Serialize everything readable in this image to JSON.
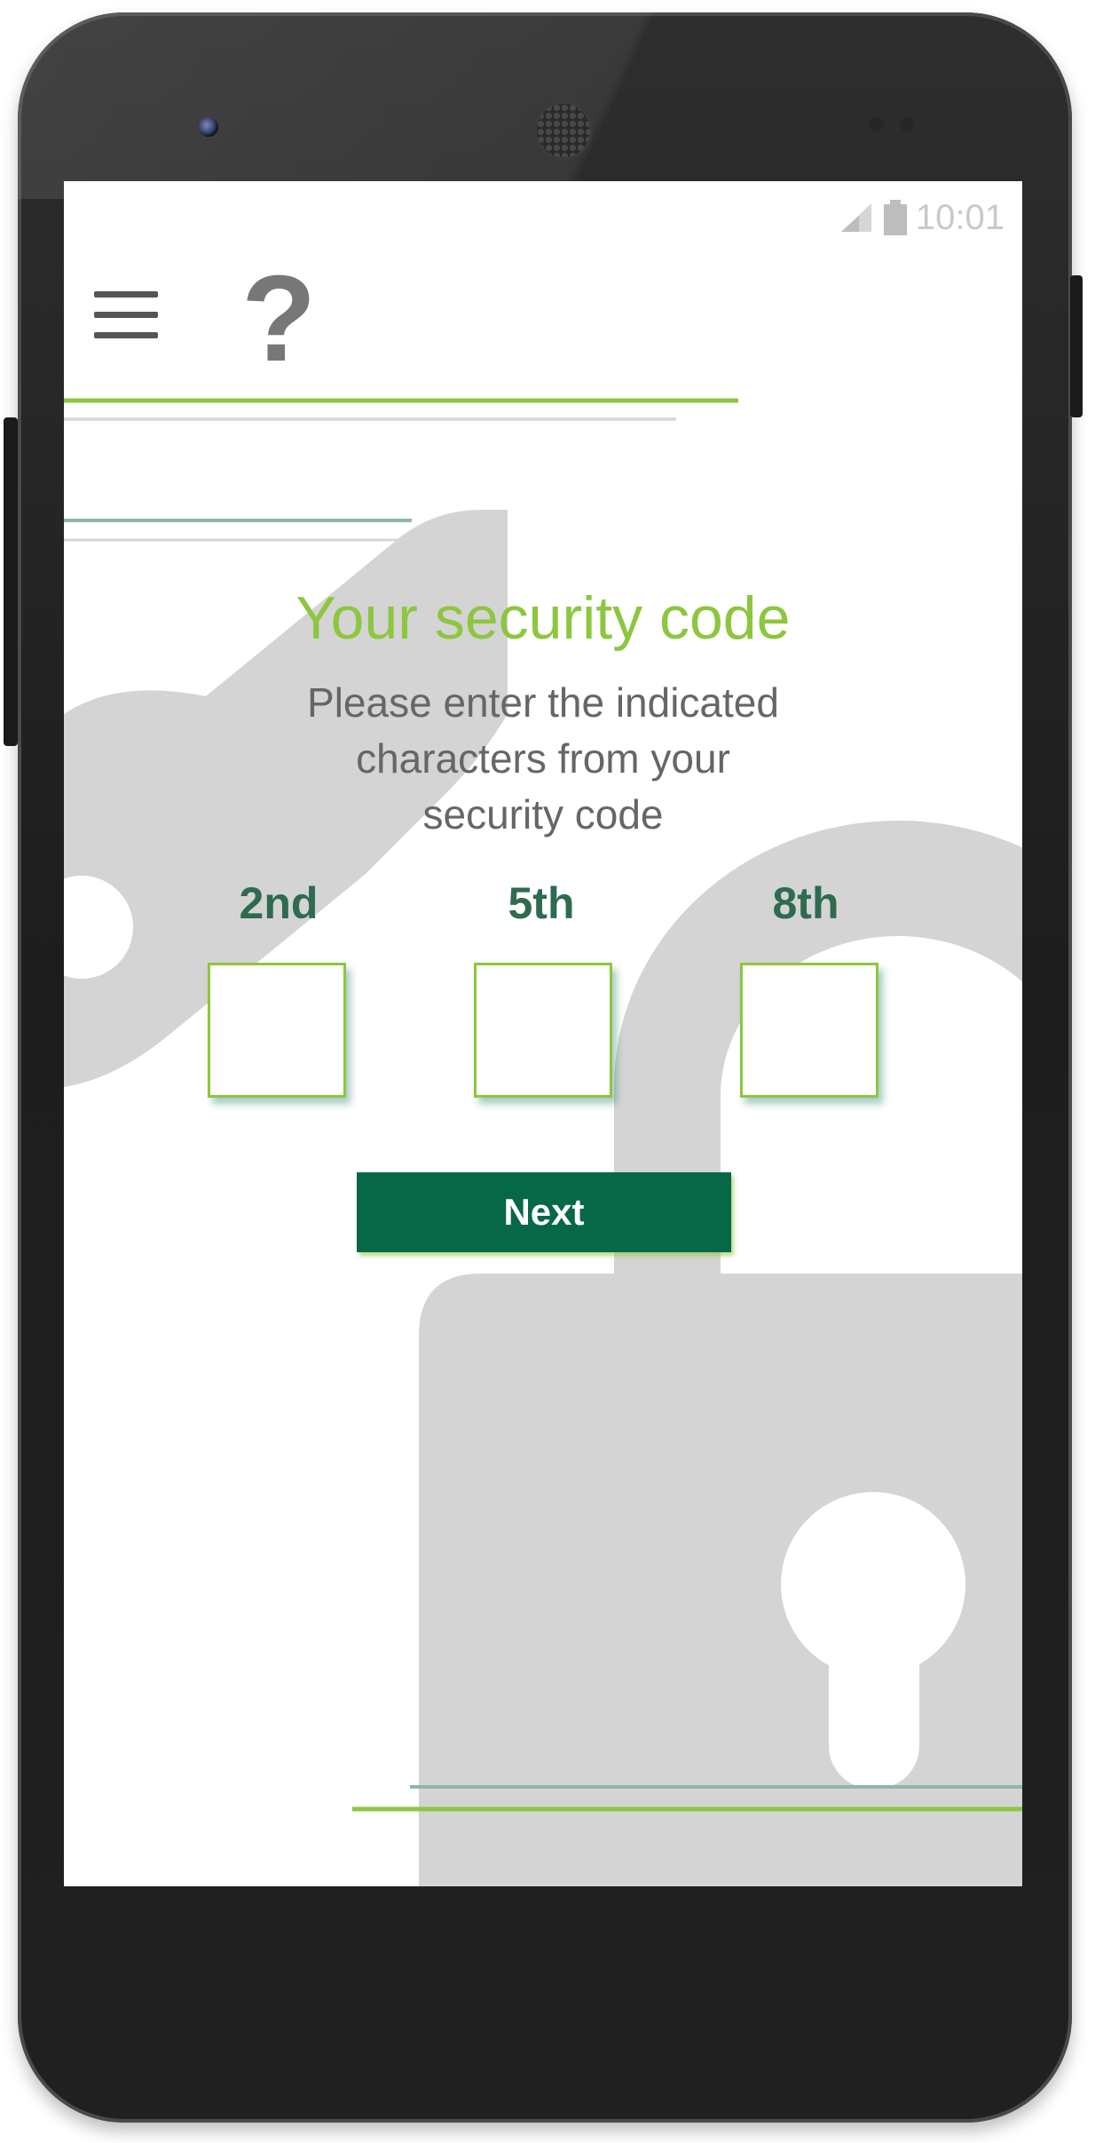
{
  "status_bar": {
    "time": "10:01",
    "icons": [
      "signal-icon",
      "battery-icon"
    ]
  },
  "header": {
    "menu_icon": "hamburger-menu-icon",
    "help_icon": "help-icon",
    "help_glyph": "?"
  },
  "main": {
    "title": "Your security code",
    "subtitle_lines": [
      "Please enter the indicated",
      "characters from your",
      "security code"
    ],
    "code_fields": [
      {
        "label": "2nd",
        "value": ""
      },
      {
        "label": "5th",
        "value": ""
      },
      {
        "label": "8th",
        "value": ""
      }
    ],
    "next_button": "Next"
  },
  "colors": {
    "accent_green": "#8dc63f",
    "button_green": "#076848",
    "label_green": "#2e6b4f",
    "text_gray": "#666666",
    "lock_gray": "#d4d4d4"
  }
}
